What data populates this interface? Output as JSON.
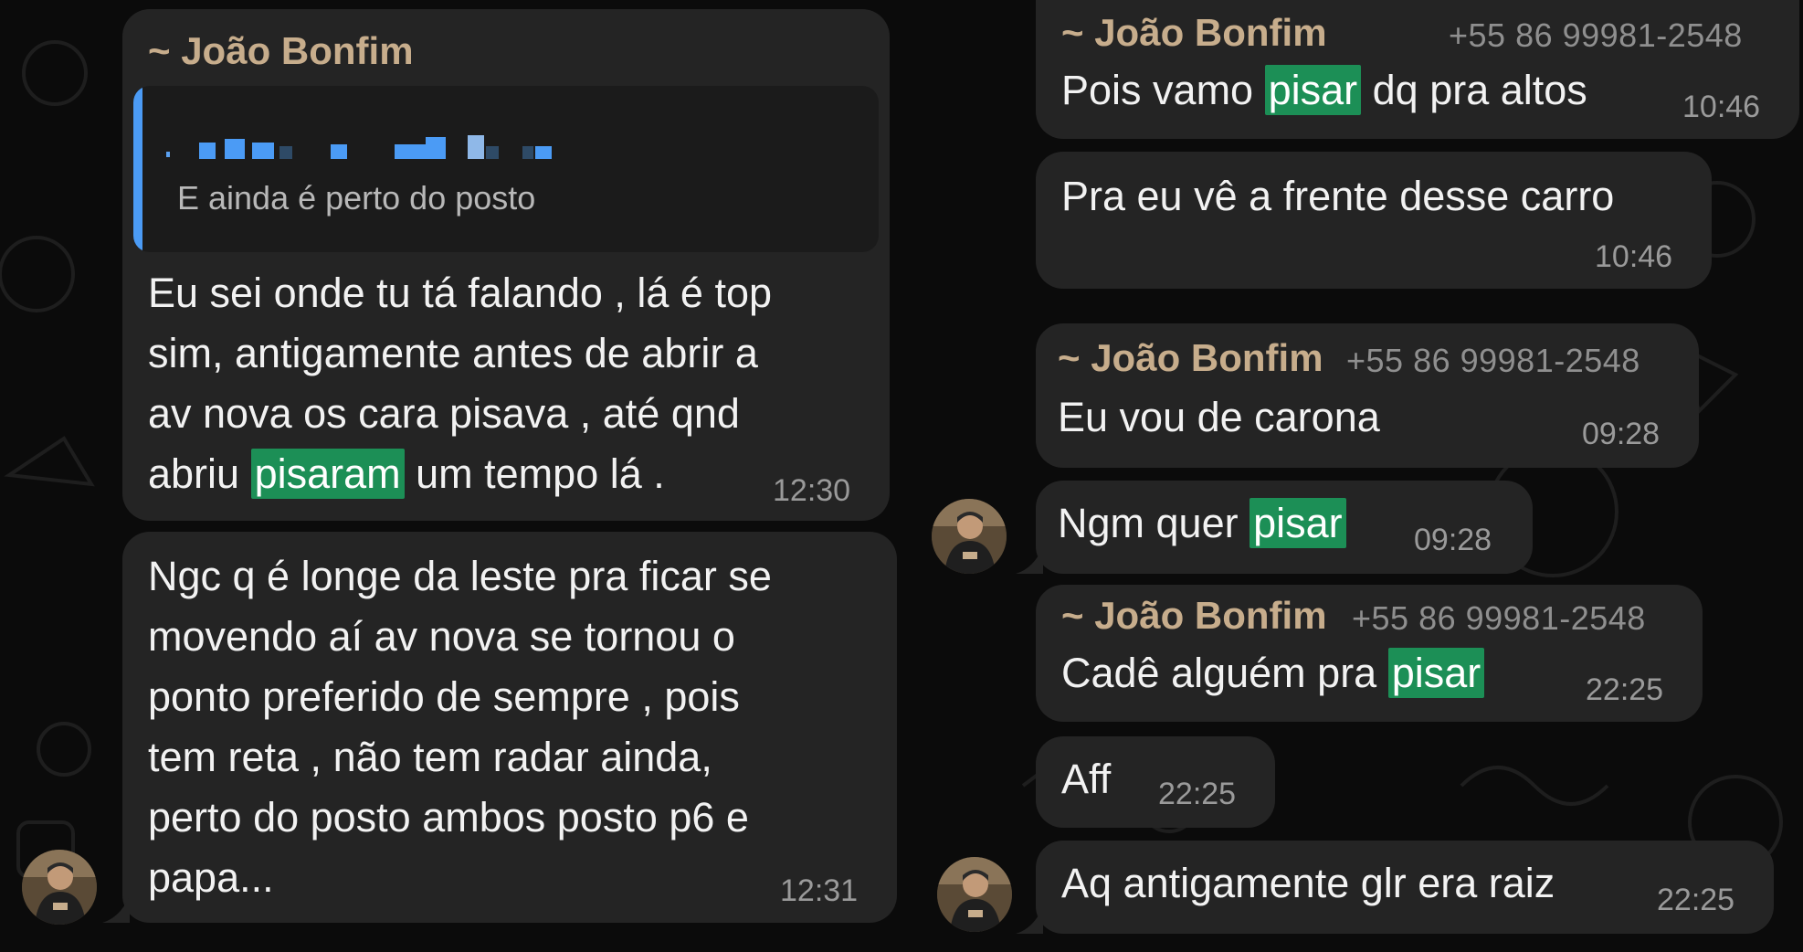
{
  "colors": {
    "background": "#0b0b0b",
    "bubble": "#242424",
    "sender": "#c7ad8c",
    "highlight": "#1c8f56",
    "quote_bar": "#4b9bf5"
  },
  "left": {
    "msg1": {
      "sender": "~ João Bonfim",
      "quote_text": "E ainda é perto do posto",
      "lines": [
        "Eu sei onde tu tá falando , lá é top",
        "sim, antigamente antes de abrir a",
        "av nova os cara pisava , até qnd"
      ],
      "last_pre": "abriu ",
      "last_hl": "pisaram",
      "last_post": " um tempo lá .",
      "time": "12:30"
    },
    "msg2": {
      "lines": [
        "Ngc q é longe da leste pra ficar se",
        "movendo aí av nova se tornou o",
        "ponto preferido de sempre , pois",
        "tem reta , não tem radar ainda,",
        "perto do posto ambos posto p6 e",
        "papa..."
      ],
      "time": "12:31"
    }
  },
  "right": {
    "r1": {
      "sender": "~ João Bonfim",
      "phone": "+55 86 99981-2548",
      "pre": "Pois vamo ",
      "hl": "pisar",
      "post": " dq pra altos",
      "time": "10:46"
    },
    "r2": {
      "text": "Pra eu vê a frente desse carro",
      "time": "10:46"
    },
    "r3": {
      "sender": "~ João Bonfim",
      "phone": "+55 86 99981-2548",
      "text": "Eu vou de carona",
      "time": "09:28"
    },
    "r4": {
      "pre": "Ngm quer ",
      "hl": "pisar",
      "time": "09:28"
    },
    "r5": {
      "sender": "~ João Bonfim",
      "phone": "+55 86 99981-2548",
      "pre": "Cadê alguém pra ",
      "hl": "pisar",
      "time": "22:25"
    },
    "r6": {
      "text": "Aff",
      "time": "22:25"
    },
    "r7": {
      "text": "Aq antigamente glr era raiz",
      "time": "22:25"
    }
  }
}
